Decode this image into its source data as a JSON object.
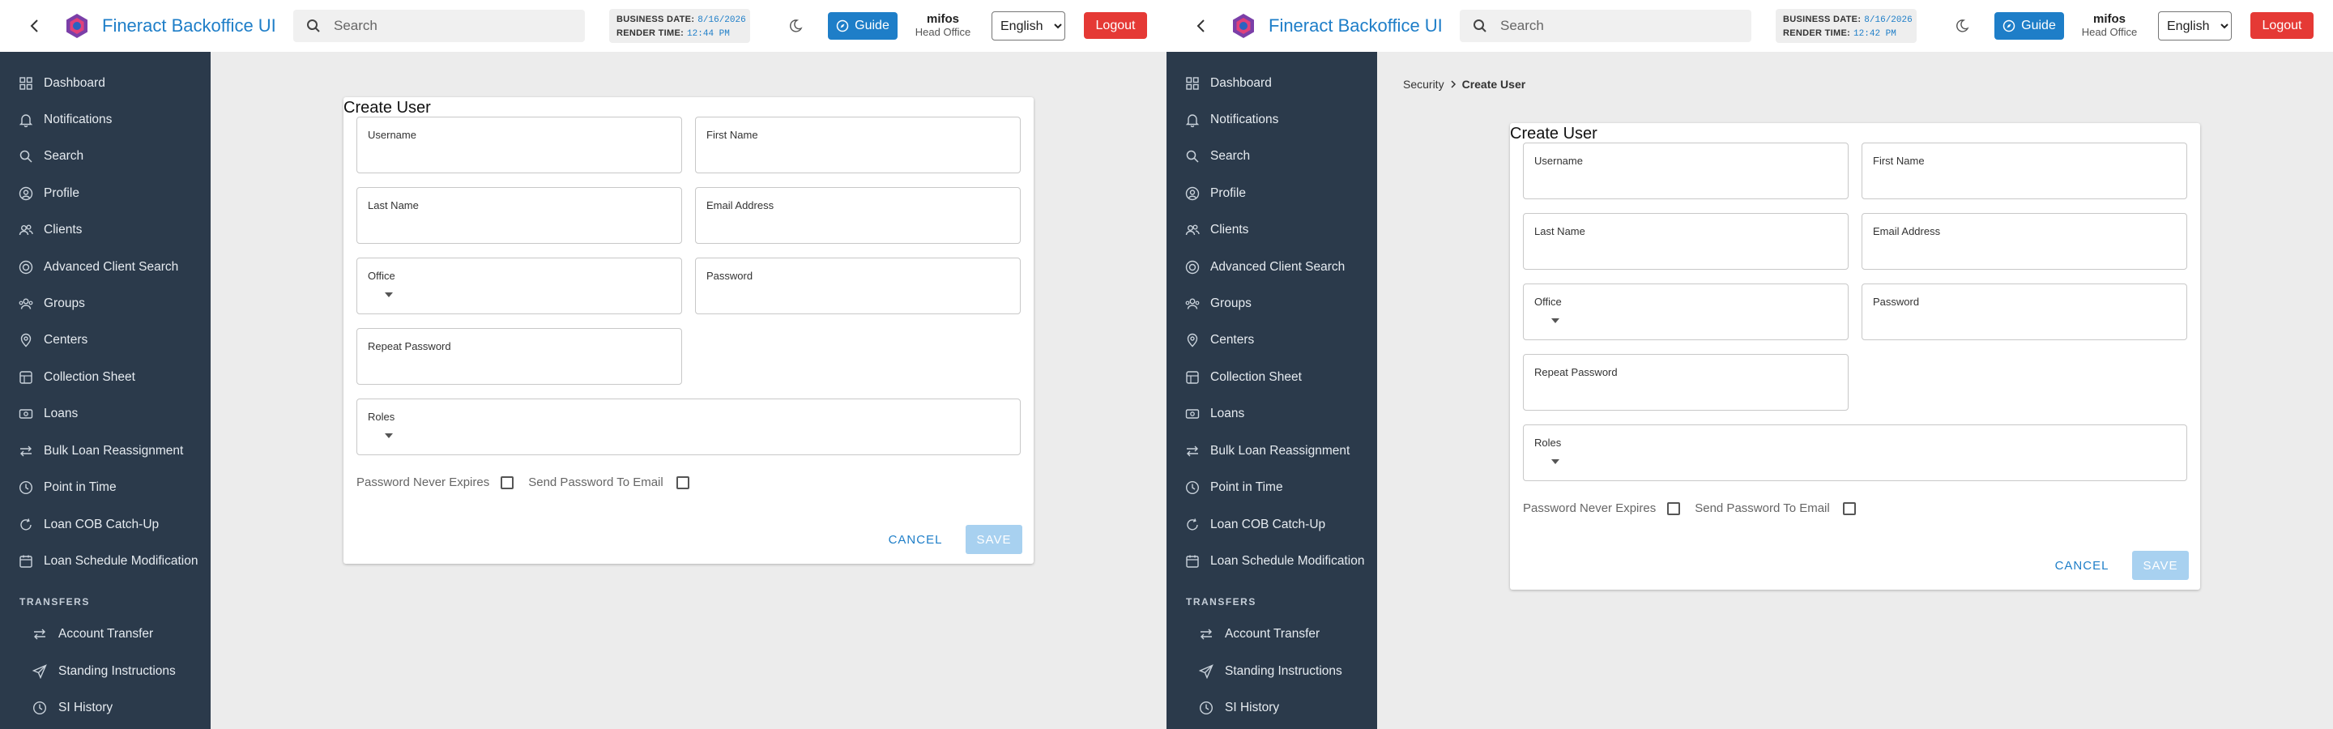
{
  "app": {
    "title": "Fineract Backoffice UI"
  },
  "search": {
    "placeholder": "Search"
  },
  "business": {
    "date_label": "BUSINESS DATE:",
    "date_value": "8/16/2026",
    "render_label": "RENDER TIME:"
  },
  "guide": {
    "label": "Guide"
  },
  "user": {
    "name": "mifos",
    "office": "Head Office"
  },
  "language": {
    "selected": "English"
  },
  "logout": {
    "label": "Logout"
  },
  "sidebar": {
    "items": [
      {
        "label": "Dashboard",
        "icon": "grid-icon"
      },
      {
        "label": "Notifications",
        "icon": "bell-icon"
      },
      {
        "label": "Search",
        "icon": "search-icon"
      },
      {
        "label": "Profile",
        "icon": "user-circle-icon"
      },
      {
        "label": "Clients",
        "icon": "users-icon"
      },
      {
        "label": "Advanced Client Search",
        "icon": "target-icon"
      },
      {
        "label": "Groups",
        "icon": "group-icon"
      },
      {
        "label": "Centers",
        "icon": "map-pin-icon"
      },
      {
        "label": "Collection Sheet",
        "icon": "sheet-icon"
      },
      {
        "label": "Loans",
        "icon": "money-icon"
      },
      {
        "label": "Bulk Loan Reassignment",
        "icon": "arrows-icon"
      },
      {
        "label": "Point in Time",
        "icon": "clock-icon"
      },
      {
        "label": "Loan COB Catch-Up",
        "icon": "refresh-icon"
      },
      {
        "label": "Loan Schedule Modification",
        "icon": "calendar-icon"
      }
    ],
    "transfers_label": "TRANSFERS",
    "transfers": [
      {
        "label": "Account Transfer",
        "icon": "arrows-icon"
      },
      {
        "label": "Standing Instructions",
        "icon": "send-icon"
      },
      {
        "label": "SI History",
        "icon": "clock-icon"
      }
    ]
  },
  "breadcrumb": {
    "parent": "Security",
    "current": "Create User"
  },
  "form": {
    "title": "Create User",
    "username_label": "Username",
    "firstname_label": "First Name",
    "lastname_label": "Last Name",
    "email_label": "Email Address",
    "office_label": "Office",
    "password_label": "Password",
    "repeat_password_label": "Repeat Password",
    "roles_label": "Roles",
    "password_never_expires_label": "Password Never Expires",
    "send_password_label": "Send Password To Email",
    "cancel_label": "CANCEL",
    "save_label": "SAVE"
  },
  "panes": [
    {
      "render_time": "12:44 PM"
    },
    {
      "render_time": "12:42 PM"
    }
  ],
  "colors": {
    "accent": "#1e7ec8",
    "sidebar": "#2b3a4b",
    "logout": "#e53935",
    "save_disabled": "#a8d1f0"
  }
}
